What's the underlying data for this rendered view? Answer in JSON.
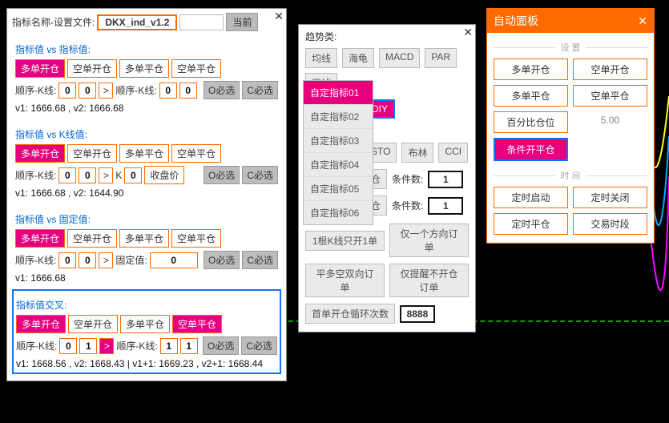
{
  "panel1": {
    "label_filename": "指标名称-设置文件:",
    "filename": "DKX_ind_v1.2",
    "btn_current": "当前",
    "sections": [
      {
        "title": "指标值 vs 指标值:",
        "btns": [
          "多单开仓",
          "空单开仓",
          "多单平仓",
          "空单平仓"
        ],
        "sel_idx": 0,
        "seq1_label": "顺序-K线:",
        "a": "0",
        "b": "0",
        "gt": ">",
        "gt_sel": false,
        "seq2_label": "顺序-K线:",
        "c": "0",
        "d": "0",
        "o_must": "O必选",
        "c_must": "C必选",
        "vals": "v1: 1666.68 , v2: 1666.68",
        "box_selected": false,
        "second_mode": "seq"
      },
      {
        "title": "指标值 vs K线值:",
        "btns": [
          "多单开仓",
          "空单开仓",
          "多单平仓",
          "空单平仓"
        ],
        "sel_idx": 0,
        "seq1_label": "顺序-K线:",
        "a": "0",
        "b": "0",
        "gt": ">",
        "gt_sel": false,
        "seq2_label": "K",
        "c": "0",
        "d": "",
        "extra_btn": "收盘价",
        "o_must": "O必选",
        "c_must": "C必选",
        "vals": "v1: 1666.68 , v2: 1644.90",
        "box_selected": false,
        "second_mode": "k"
      },
      {
        "title": "指标值 vs 固定值:",
        "btns": [
          "多单开仓",
          "空单开仓",
          "多单平仓",
          "空单平仓"
        ],
        "sel_idx": 0,
        "seq1_label": "顺序-K线:",
        "a": "0",
        "b": "0",
        "gt": ">",
        "gt_sel": false,
        "seq2_label": "固定值:",
        "c": "0",
        "d": "",
        "o_must": "O必选",
        "c_must": "C必选",
        "vals": "v1: 1666.68",
        "box_selected": false,
        "second_mode": "fixed"
      },
      {
        "title": "指标值交叉:",
        "btns": [
          "多单开仓",
          "空单开仓",
          "多单平仓",
          "空单平仓"
        ],
        "sel_idx": 0,
        "extra_sel": 3,
        "seq1_label": "顺序-K线:",
        "a": "0",
        "b": "1",
        "gt": ">",
        "gt_sel": true,
        "seq2_label": "顺序-K线:",
        "c": "1",
        "d": "1",
        "o_must": "O必选",
        "c_must": "C必选",
        "vals": "v1: 1668.56 , v2: 1668.43 | v1+1: 1669.23 , v2+1: 1668.44",
        "box_selected": true,
        "second_mode": "seq"
      }
    ]
  },
  "panel2": {
    "title": "趋势类:",
    "tags_row1": [
      "均线",
      "海龟",
      "MACD",
      "PAR",
      "画线"
    ],
    "diy": "DIY",
    "tags_row2": [
      "STO",
      "布林",
      "CCI"
    ],
    "cond_rows": [
      {
        "left": "仓",
        "mid": "条件数:",
        "val": "1"
      },
      {
        "left": "仓",
        "mid": "条件数:",
        "val": "1"
      }
    ],
    "wide_btns": [
      [
        "1根K线只开1单",
        "仅一个方向订单"
      ],
      [
        "平多空双向订单",
        "仅提醒不开仓订单"
      ]
    ],
    "loop_label": "首单开仓循环次数",
    "loop_val": "8888"
  },
  "dropdown": {
    "items": [
      "自定指标01",
      "自定指标02",
      "自定指标03",
      "自定指标04",
      "自定指标05",
      "自定指标06"
    ],
    "sel": 0
  },
  "panel4": {
    "header": "自动面板",
    "group1_label": "设 置",
    "grid1": [
      [
        "多单开仓",
        "空单开仓"
      ],
      [
        "多单平仓",
        "空单平仓"
      ],
      [
        "百分比仓位",
        "5.00"
      ],
      [
        "条件开平仓",
        ""
      ]
    ],
    "group2_label": "时 间",
    "grid2": [
      [
        "定时启动",
        "定时关闭"
      ],
      [
        "定时平仓",
        "交易时段"
      ]
    ]
  }
}
